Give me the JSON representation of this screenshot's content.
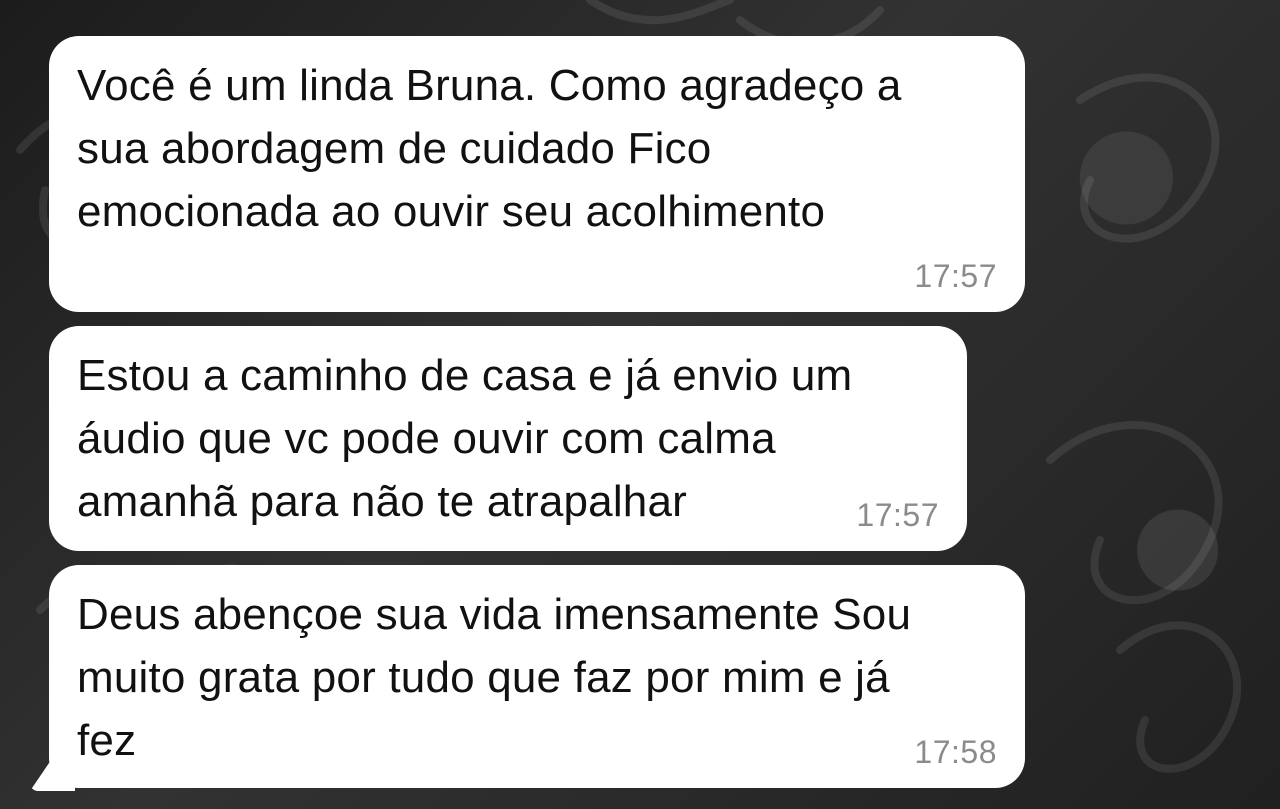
{
  "messages": [
    {
      "text": "Você é um linda Bruna. Como agradeço a\nsua abordagem de cuidado Fico\nemocionada ao ouvir seu acolhimento",
      "time": "17:57"
    },
    {
      "text": "Estou a caminho de casa e já envio um\náudio que vc pode ouvir com calma\namanhã para não te atrapalhar",
      "time": "17:57"
    },
    {
      "text": "Deus abençoe sua vida imensamente Sou\nmuito grata por tudo que faz por mim e já\nfez",
      "time": "17:58"
    }
  ],
  "background": {
    "pattern": "dark-damask",
    "colors": [
      "#1c1c1c",
      "#323232",
      "#202020"
    ]
  }
}
